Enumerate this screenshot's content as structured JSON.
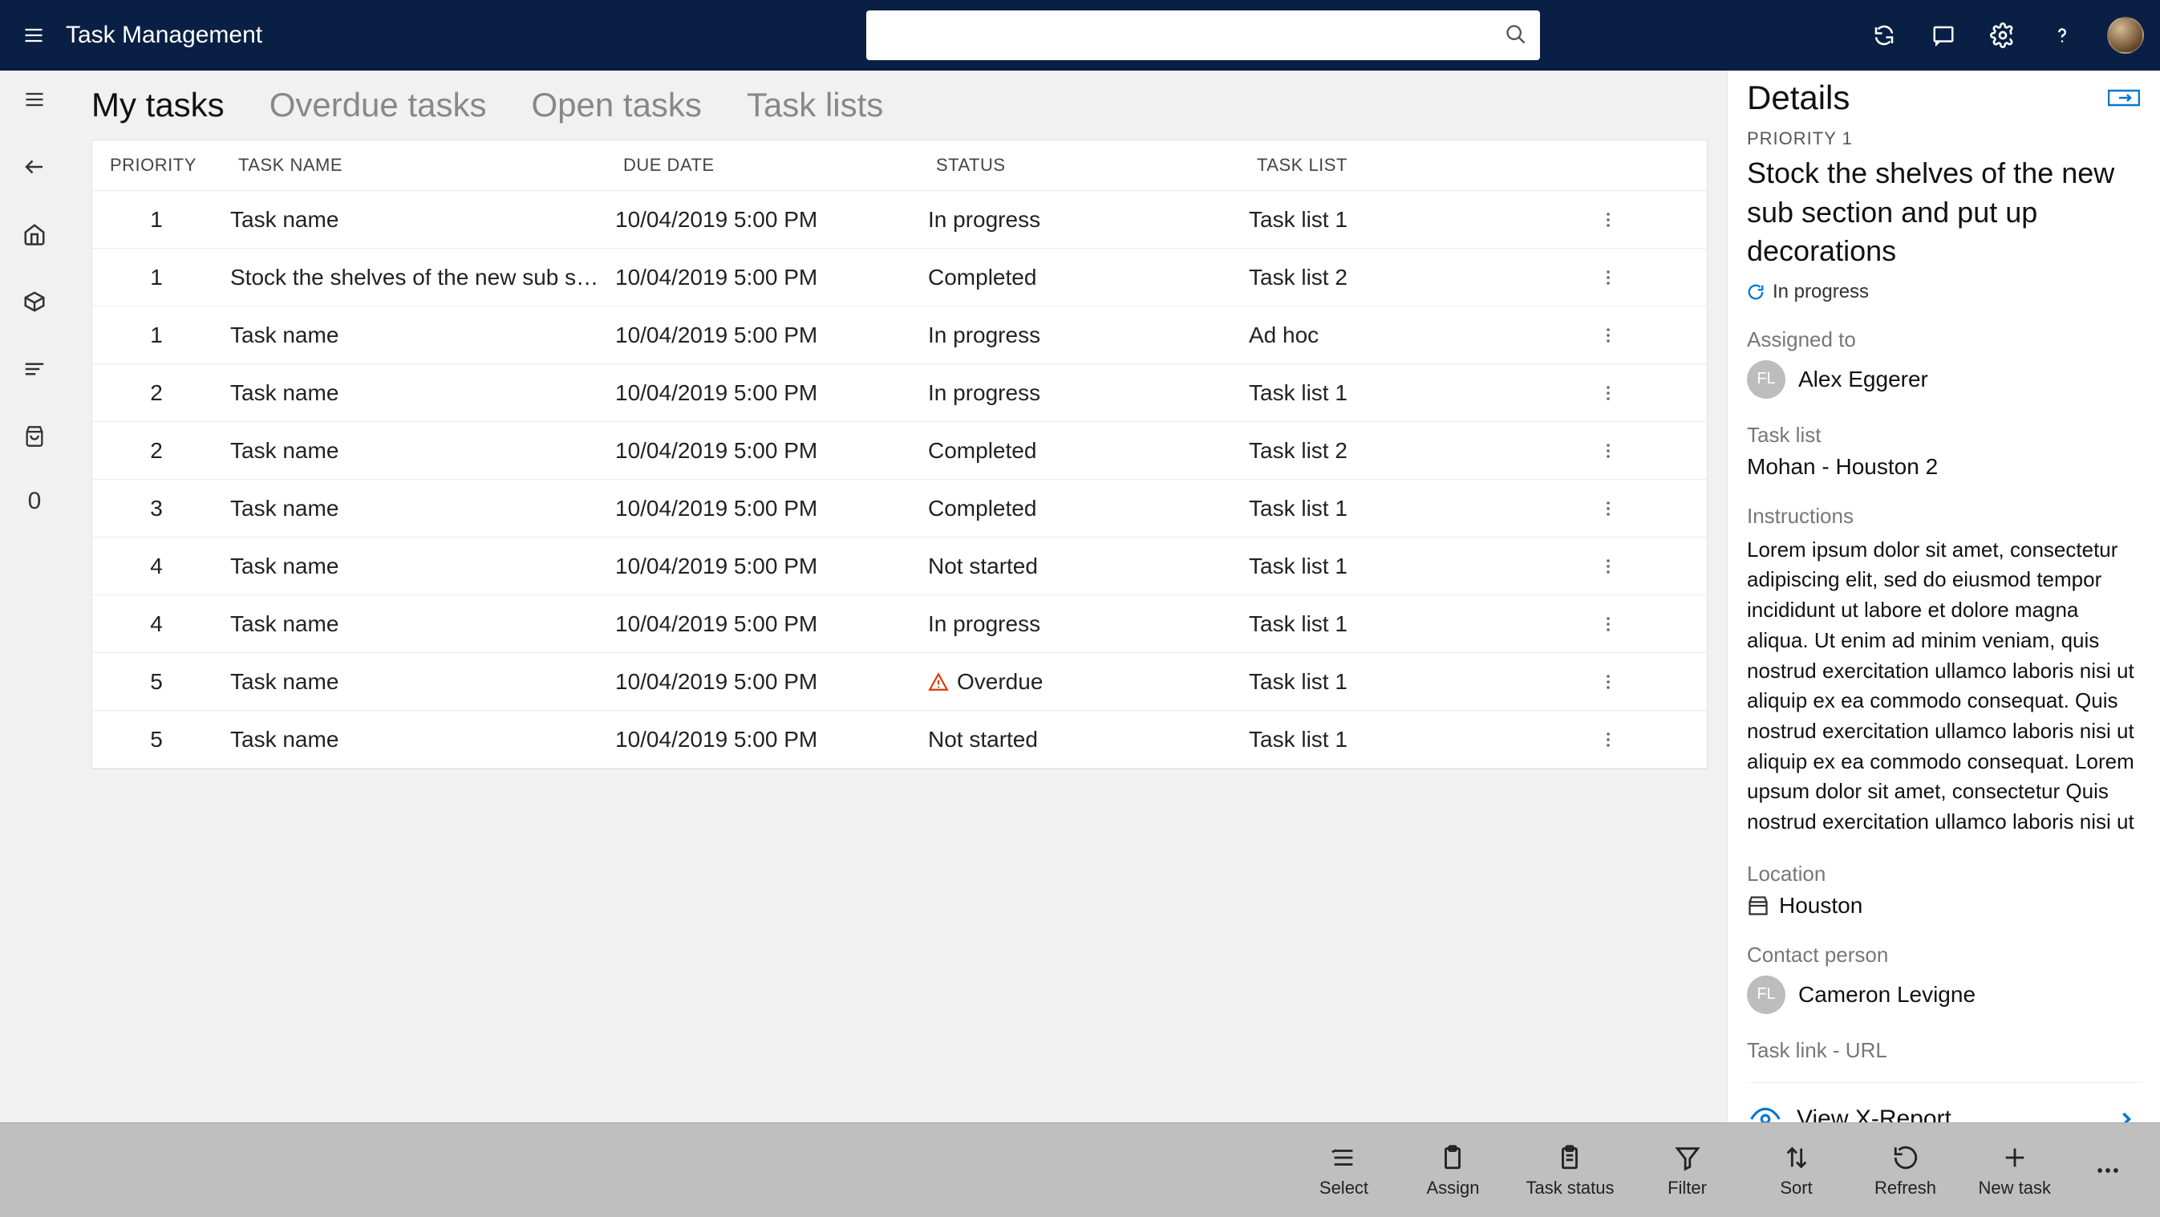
{
  "header": {
    "title": "Task Management",
    "search_placeholder": ""
  },
  "rail": {
    "zero_label": "0"
  },
  "tabs": [
    {
      "label": "My tasks",
      "active": true
    },
    {
      "label": "Overdue tasks",
      "active": false
    },
    {
      "label": "Open tasks",
      "active": false
    },
    {
      "label": "Task lists",
      "active": false
    }
  ],
  "table": {
    "columns": {
      "priority": "PRIORITY",
      "name": "TASK NAME",
      "due": "DUE DATE",
      "status": "STATUS",
      "tasklist": "TASK LIST"
    },
    "rows": [
      {
        "priority": "1",
        "name": "Task name",
        "due": "10/04/2019 5:00 PM",
        "status": "In progress",
        "tasklist": "Task list 1",
        "overdue": false
      },
      {
        "priority": "1",
        "name": "Stock the shelves of the new sub section…",
        "due": "10/04/2019 5:00 PM",
        "status": "Completed",
        "tasklist": "Task list 2",
        "overdue": false
      },
      {
        "priority": "1",
        "name": "Task name",
        "due": "10/04/2019 5:00 PM",
        "status": "In progress",
        "tasklist": "Ad hoc",
        "overdue": false
      },
      {
        "priority": "2",
        "name": "Task name",
        "due": "10/04/2019 5:00 PM",
        "status": "In progress",
        "tasklist": "Task list 1",
        "overdue": false
      },
      {
        "priority": "2",
        "name": "Task name",
        "due": "10/04/2019 5:00 PM",
        "status": "Completed",
        "tasklist": "Task list 2",
        "overdue": false
      },
      {
        "priority": "3",
        "name": "Task name",
        "due": "10/04/2019 5:00 PM",
        "status": "Completed",
        "tasklist": "Task list 1",
        "overdue": false
      },
      {
        "priority": "4",
        "name": "Task name",
        "due": "10/04/2019 5:00 PM",
        "status": "Not started",
        "tasklist": "Task list 1",
        "overdue": false
      },
      {
        "priority": "4",
        "name": "Task name",
        "due": "10/04/2019 5:00 PM",
        "status": "In progress",
        "tasklist": "Task list 1",
        "overdue": false
      },
      {
        "priority": "5",
        "name": "Task name",
        "due": "10/04/2019 5:00 PM",
        "status": "Overdue",
        "tasklist": "Task list 1",
        "overdue": true
      },
      {
        "priority": "5",
        "name": "Task name",
        "due": "10/04/2019 5:00 PM",
        "status": "Not started",
        "tasklist": "Task list 1",
        "overdue": false
      }
    ]
  },
  "details": {
    "heading": "Details",
    "priority_label": "PRIORITY 1",
    "title": "Stock the shelves of the new sub section and put up decorations",
    "status": "In progress",
    "assigned_to_label": "Assigned to",
    "assigned_to": {
      "initials": "FL",
      "name": "Alex Eggerer"
    },
    "tasklist_label": "Task list",
    "tasklist": "Mohan - Houston 2",
    "instructions_label": "Instructions",
    "instructions": "Lorem ipsum dolor sit amet, consectetur adipiscing elit, sed do eiusmod tempor incididunt ut labore et dolore magna aliqua. Ut enim ad minim veniam, quis nostrud exercitation ullamco laboris nisi ut aliquip ex ea commodo consequat. Quis nostrud exercitation ullamco laboris nisi ut aliquip ex ea commodo consequat. Lorem upsum dolor sit amet, consectetur Quis nostrud exercitation ullamco laboris nisi ut",
    "location_label": "Location",
    "location": "Houston",
    "contact_label": "Contact person",
    "contact": {
      "initials": "FL",
      "name": "Cameron Levigne"
    },
    "link_label": "Task link - URL",
    "link_text": "View X-Report"
  },
  "cmdbar": {
    "select": "Select",
    "assign": "Assign",
    "taskstatus": "Task status",
    "filter": "Filter",
    "sort": "Sort",
    "refresh": "Refresh",
    "newtask": "New task"
  }
}
